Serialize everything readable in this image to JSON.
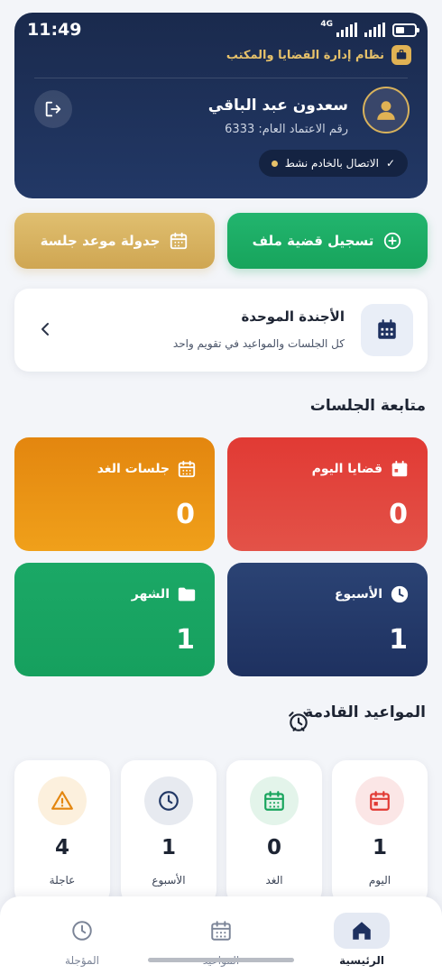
{
  "status_bar": {
    "time": "11:49",
    "network": "4G"
  },
  "header": {
    "system_title": "نظام إدارة القضايا والمكتب",
    "user_name": "سعدون عبد الباقي",
    "user_id_text": "رقم الاعتماد العام: 6333",
    "connection_status": "الاتصال بالخادم نشط"
  },
  "actions": {
    "register_case": "تسجيل قضية ملف",
    "schedule_session": "جدولة موعد جلسة"
  },
  "agenda": {
    "title": "الأجندة الموحدة",
    "subtitle": "كل الجلسات والمواعيد في تقويم واحد"
  },
  "sessions": {
    "section_title": "متابعة الجلسات",
    "today": {
      "label": "قضايا اليوم",
      "value": "0"
    },
    "tomorrow": {
      "label": "جلسات الغد",
      "value": "0"
    },
    "week": {
      "label": "الأسبوع",
      "value": "1"
    },
    "month": {
      "label": "الشهر",
      "value": "1"
    }
  },
  "upcoming": {
    "section_title": "المواعيد القادمة",
    "today": {
      "label": "اليوم",
      "value": "1"
    },
    "tomorrow": {
      "label": "الغد",
      "value": "0"
    },
    "week": {
      "label": "الأسبوع",
      "value": "1"
    },
    "urgent": {
      "label": "عاجلة",
      "value": "4"
    }
  },
  "nav": {
    "home": "الرئيسية",
    "appointments": "المواعيد",
    "postponed": "المؤجلة"
  },
  "colors": {
    "header_bg": "#1a2a4d",
    "gold": "#e0b254",
    "green": "#17a45c",
    "red": "#e13a34",
    "orange": "#f0a01a",
    "navy": "#223866"
  }
}
